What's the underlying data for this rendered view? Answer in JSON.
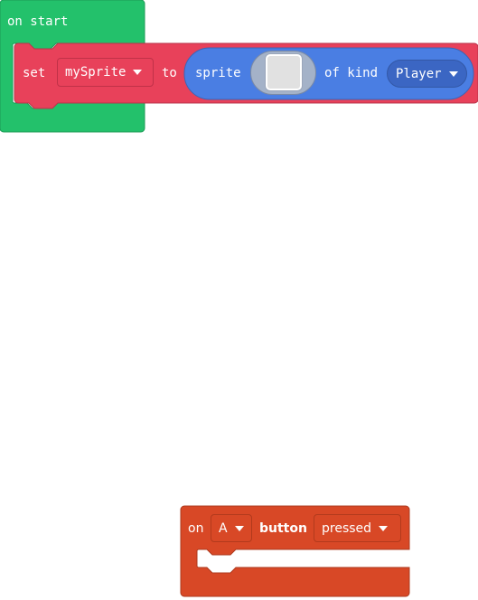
{
  "workspace": {
    "on_start_block": {
      "label": "on start",
      "color": "#23c16b",
      "set_statement": {
        "keyword_set": "set",
        "variable": "mySprite",
        "keyword_to": "to",
        "color": "#e8415a",
        "value": {
          "keyword_sprite": "sprite",
          "keyword_of_kind": "of kind",
          "kind": "Player",
          "color": "#4a7ee3",
          "image_icon": "empty-image-icon"
        }
      }
    },
    "button_event_block": {
      "keyword_on": "on",
      "button": "A",
      "keyword_button": "button",
      "event": "pressed",
      "color": "#d84826"
    }
  },
  "icons": {
    "dropdown": "caret-down-icon"
  }
}
